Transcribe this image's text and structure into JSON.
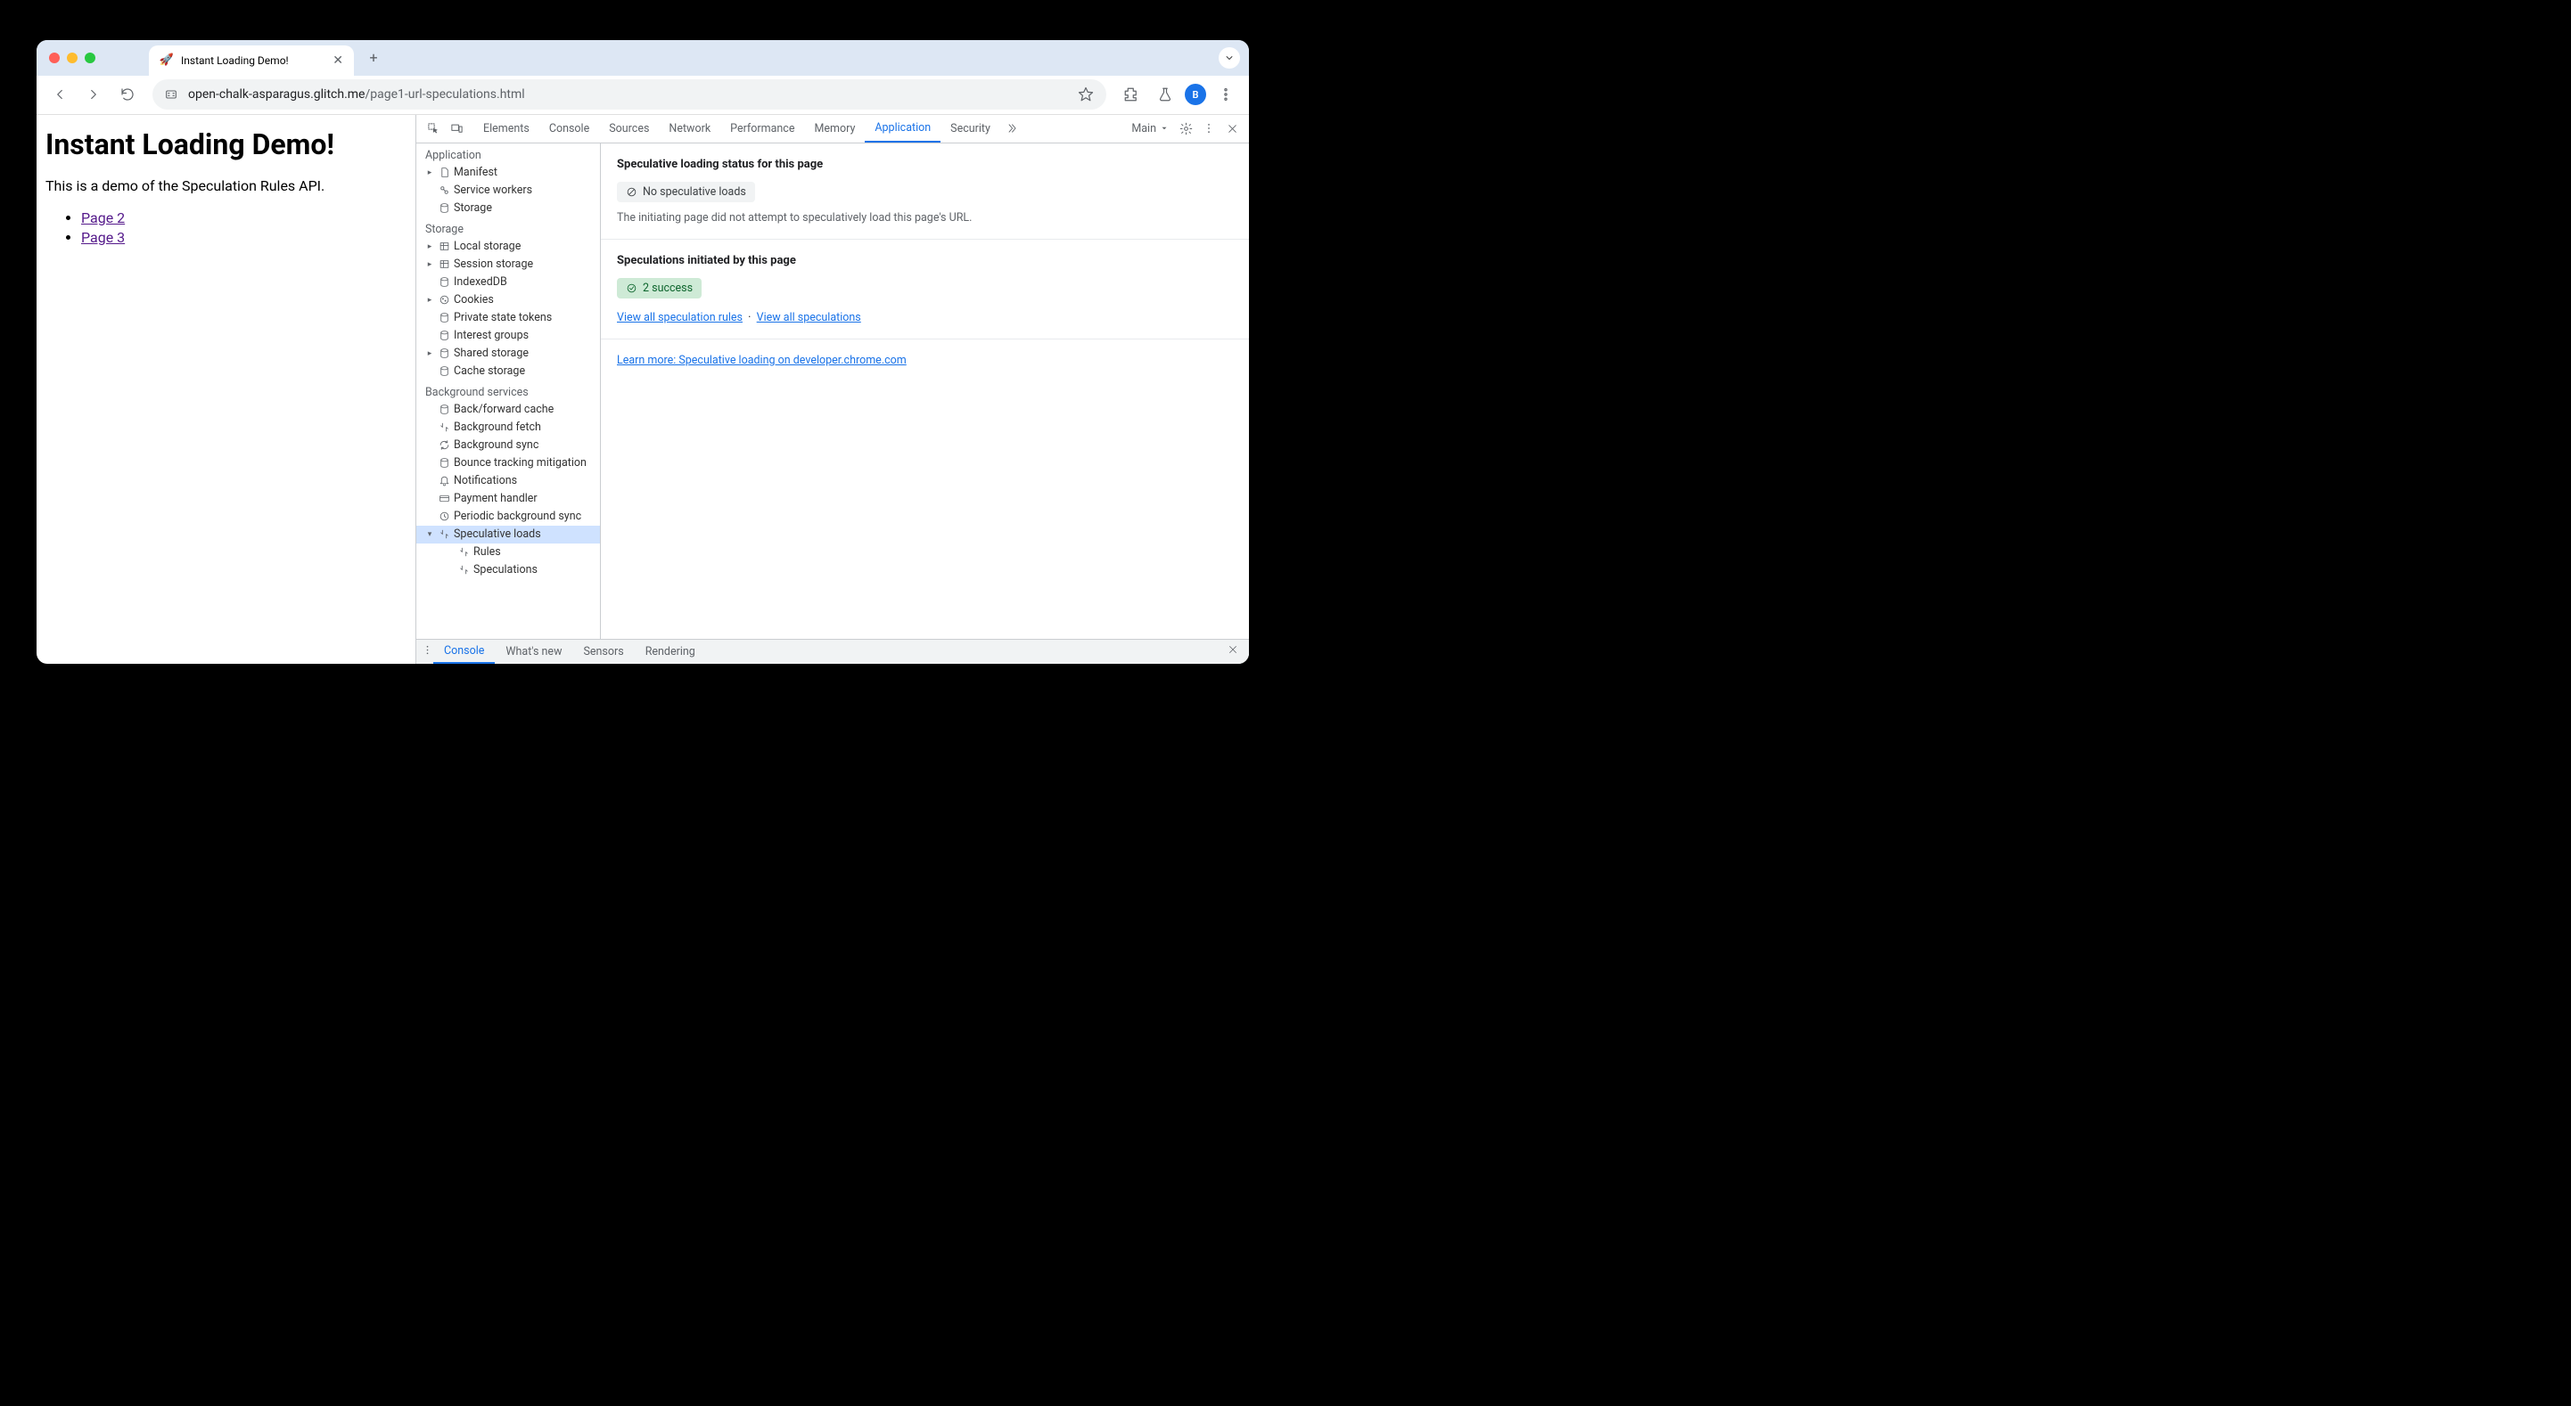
{
  "tab": {
    "favicon": "🚀",
    "title": "Instant Loading Demo!"
  },
  "url": {
    "host": "open-chalk-asparagus.glitch.me",
    "path": "/page1-url-speculations.html"
  },
  "avatar_letter": "B",
  "page": {
    "heading": "Instant Loading Demo!",
    "intro": "This is a demo of the Speculation Rules API.",
    "links": [
      "Page 2",
      "Page 3"
    ]
  },
  "devtools": {
    "tabs": [
      "Elements",
      "Console",
      "Sources",
      "Network",
      "Performance",
      "Memory",
      "Application",
      "Security"
    ],
    "active_tab": "Application",
    "frame_label": "Main",
    "sidebar": {
      "group_app": "Application",
      "app_items": [
        "Manifest",
        "Service workers",
        "Storage"
      ],
      "group_storage": "Storage",
      "storage_items": [
        "Local storage",
        "Session storage",
        "IndexedDB",
        "Cookies",
        "Private state tokens",
        "Interest groups",
        "Shared storage",
        "Cache storage"
      ],
      "group_bg": "Background services",
      "bg_items": [
        "Back/forward cache",
        "Background fetch",
        "Background sync",
        "Bounce tracking mitigation",
        "Notifications",
        "Payment handler",
        "Periodic background sync",
        "Speculative loads"
      ],
      "spec_children": [
        "Rules",
        "Speculations"
      ]
    },
    "panel": {
      "status_heading": "Speculative loading status for this page",
      "status_chip": "No speculative loads",
      "status_msg": "The initiating page did not attempt to speculatively load this page's URL.",
      "init_heading": "Speculations initiated by this page",
      "init_chip": "2 success",
      "link_rules": "View all speculation rules",
      "link_specs": "View all speculations",
      "learn": "Learn more: Speculative loading on developer.chrome.com"
    },
    "drawer": [
      "Console",
      "What's new",
      "Sensors",
      "Rendering"
    ],
    "drawer_active": "Console"
  }
}
